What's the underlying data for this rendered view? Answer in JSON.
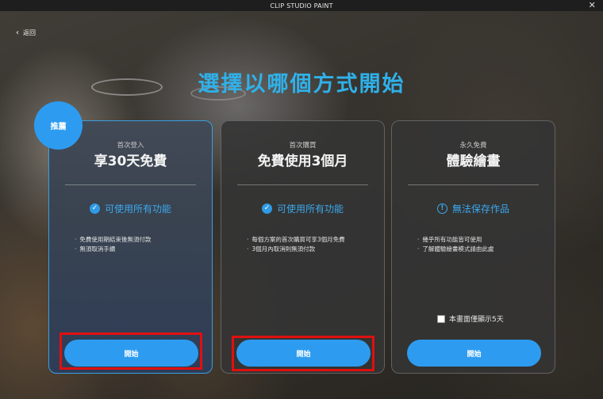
{
  "window": {
    "title": "CLIP STUDIO PAINT",
    "close_glyph": "✕"
  },
  "nav": {
    "back_label": "返回",
    "back_glyph": "‹"
  },
  "heading": "選擇以哪個方式開始",
  "badge": "推薦",
  "plans": [
    {
      "subtitle": "首次登入",
      "title": "享30天免費",
      "feature": "可使用所有功能",
      "feature_icon": "check-circle-icon",
      "details": [
        "免費使用期結束後無須付款",
        "無須取消手續"
      ],
      "button": "開始"
    },
    {
      "subtitle": "首次購買",
      "title": "免費使用3個月",
      "feature": "可使用所有功能",
      "feature_icon": "check-circle-icon",
      "details": [
        "每個方案的首次購買可享3個月免費",
        "3個月內取消則無須付款"
      ],
      "button": "開始"
    },
    {
      "subtitle": "永久免費",
      "title": "體驗繪畫",
      "feature": "無法保存作品",
      "feature_icon": "info-circle-icon",
      "details": [
        "幾乎所有功能皆可使用",
        "了解體驗繪畫模式請由此處"
      ],
      "checkbox_label": "本畫面僅顯示5天",
      "button": "開始"
    }
  ],
  "colors": {
    "accent": "#2d9cf0",
    "heading": "#2fb1ea",
    "highlight": "#e01010"
  }
}
